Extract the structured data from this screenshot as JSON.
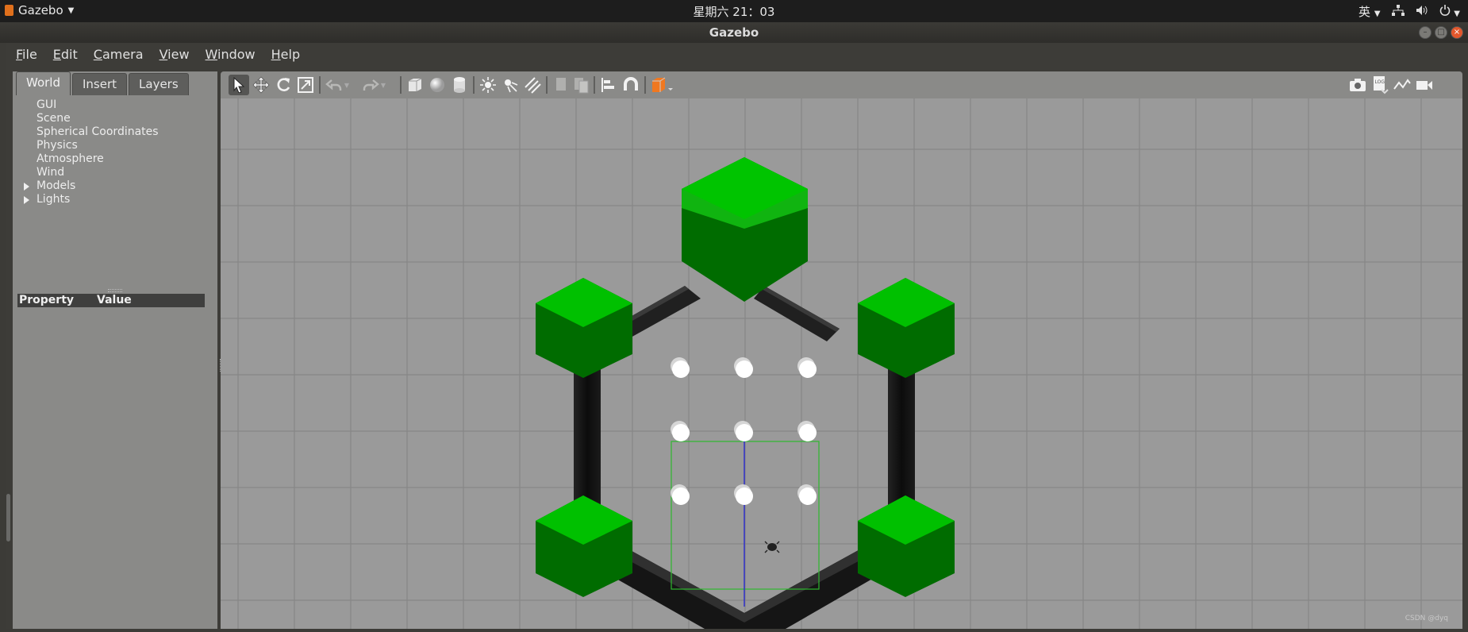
{
  "system": {
    "app_name": "Gazebo",
    "clock": "星期六 21：03",
    "input_method": "英"
  },
  "window": {
    "title": "Gazebo"
  },
  "menu": [
    "File",
    "Edit",
    "Camera",
    "View",
    "Window",
    "Help"
  ],
  "left_panel": {
    "tabs": [
      "World",
      "Insert",
      "Layers"
    ],
    "active_tab": "World",
    "tree": [
      {
        "label": "GUI",
        "expandable": false
      },
      {
        "label": "Scene",
        "expandable": false
      },
      {
        "label": "Spherical Coordinates",
        "expandable": false
      },
      {
        "label": "Physics",
        "expandable": false
      },
      {
        "label": "Atmosphere",
        "expandable": false
      },
      {
        "label": "Wind",
        "expandable": false
      },
      {
        "label": "Models",
        "expandable": true
      },
      {
        "label": "Lights",
        "expandable": true
      }
    ],
    "property_header": {
      "property": "Property",
      "value": "Value"
    }
  },
  "toolbar": {
    "left_tools": [
      "select-arrow-icon",
      "translate-icon",
      "rotate-icon",
      "scale-icon",
      "undo-icon",
      "undo-history-icon",
      "redo-icon",
      "redo-history-icon",
      "box-icon",
      "sphere-icon",
      "cylinder-icon",
      "point-light-icon",
      "spot-light-icon",
      "directional-light-icon",
      "copy-icon",
      "paste-icon",
      "align-icon",
      "snap-icon",
      "view-angle-icon"
    ],
    "right_tools": [
      "screenshot-icon",
      "log-icon",
      "plot-icon",
      "video-record-icon"
    ]
  },
  "scene": {
    "colors": {
      "ground": "#9a9a9a",
      "grid": "#7e7e7e",
      "cube": "#0b9a0b",
      "rod": "#141414",
      "ball": "#ffffff",
      "selection": "#2eb82e",
      "axis": "#2a2ad0"
    }
  },
  "watermark": "CSDN @dyq"
}
